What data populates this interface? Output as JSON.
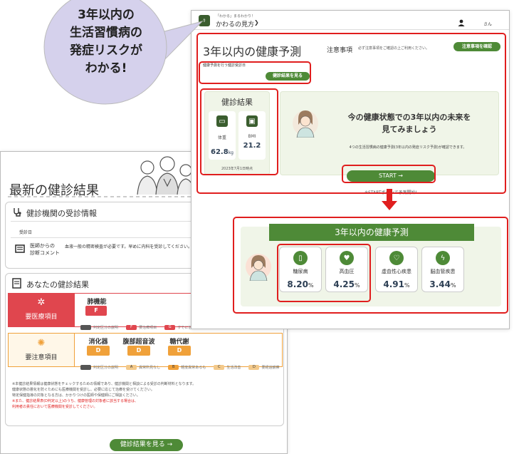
{
  "bubble": {
    "lines": [
      "3年以内の",
      "生活習慣病の",
      "発症リスクが",
      "わかる!"
    ]
  },
  "header": {
    "subtitle": "「わかる」まるわかり！",
    "title": "かわるの見方",
    "arrow": "❯",
    "user_suffix": "さん"
  },
  "prediction": {
    "title": "3年以内の健康予測",
    "notice_label": "注意事項",
    "notice_text": "必ず注意事項をご確認の上ご利用ください。",
    "notice_button": "注意事項を確認",
    "exam_label": "健康予測を行う健診受診日",
    "exam_button": "健診結果を見る",
    "results_title": "健診結果",
    "weight_label": "体重",
    "weight_value": "62.8",
    "weight_unit": "kg",
    "bmi_label": "BMI",
    "bmi_value": "21.2",
    "results_date": "2023年7月1日時点",
    "headline_1": "今の健康状態での3年以内の未来を",
    "headline_2": "見てみましょう",
    "desc": "4つの生活習慣病の健康予測(3年以内の発症リスク予測)が確認できます。",
    "start_button": "START →",
    "start_hint": "※STARTボタンで予測開始!"
  },
  "risk": {
    "title": "3年以内の健康予測",
    "items": [
      {
        "label": "糖尿病",
        "value": "8.20",
        "unit": "%"
      },
      {
        "label": "高血圧",
        "value": "4.25",
        "unit": "%"
      },
      {
        "label": "虚血性心疾患",
        "value": "4.91",
        "unit": "%"
      },
      {
        "label": "脳血管疾患",
        "value": "3.44",
        "unit": "%"
      }
    ]
  },
  "back": {
    "title": "最新の健診結果",
    "institution_title": "健診機関の受診情報",
    "visit_label": "受診日",
    "comment_label_1": "医師からの",
    "comment_label_2": "診断コメント",
    "comment_text": "血液一般の精密検査が必要です。早めに内科を受診してください。",
    "your_results_title": "あなたの健診結果",
    "row1_label": "要医療項目",
    "row2_label": "要注意項目",
    "row1_cat": "肺機能",
    "row1_grade": "F",
    "row2_cats": [
      {
        "name": "消化器",
        "grade": "D"
      },
      {
        "name": "腹部超音波",
        "grade": "D"
      },
      {
        "name": "糖代謝",
        "grade": "D"
      }
    ],
    "row1_legend": [
      "判定区分の説明",
      "F",
      "要治療項目",
      "G",
      "すでに治療中"
    ],
    "row2_legend": [
      "判定区分の説明",
      "A",
      "異常所見なし",
      "B",
      "軽度異常あるも",
      "C",
      "生活改善",
      "D",
      "要経過観察"
    ],
    "note_lines": [
      "※本健診結果情報は健康状態をチェックするための情報であり、健診機関と相談による受診の判断材料となります。",
      "健康状態の悪化を防ぐためにも医療機関を受診し、必要に応じて治療を受けてください。",
      "特定保健指導の対象となる方は、かかりつけの医師や保健師にご相談ください。"
    ],
    "note_red_lines": [
      "※また、健診結果表(D判定以上)のうち、健康管理の対象者に該当する場合は、",
      "利用者の責任において医療機関を受診してください。"
    ],
    "bottom_button": "健診結果を見る →"
  }
}
